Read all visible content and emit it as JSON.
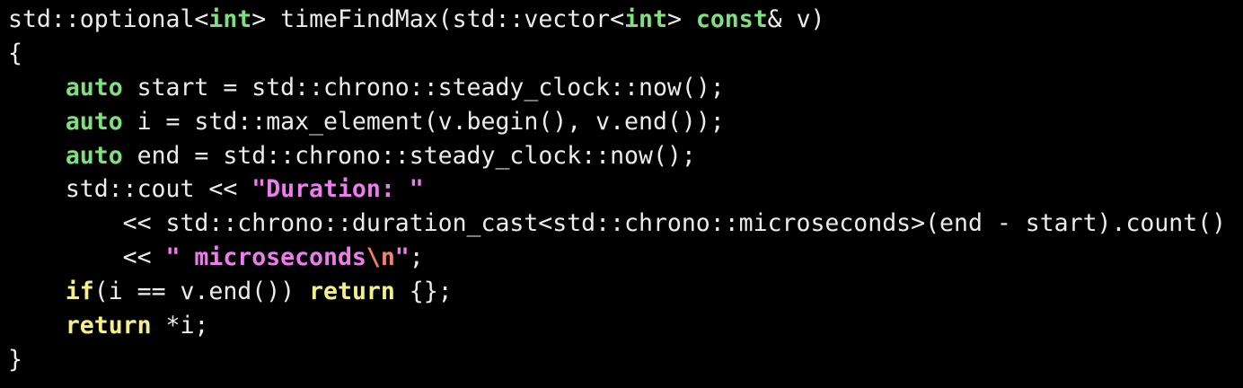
{
  "theme": {
    "background": "#000000",
    "text": "#ececec",
    "keyword_type": "#7ee07e",
    "keyword_control": "#f3f08a",
    "string": "#ee7cee",
    "escape": "#f4826a"
  },
  "code": {
    "language": "C++",
    "lines": [
      {
        "tokens": [
          {
            "t": "plain",
            "v": "std::optional<"
          },
          {
            "t": "kw",
            "v": "int"
          },
          {
            "t": "plain",
            "v": "> timeFindMax(std::vector<"
          },
          {
            "t": "kw",
            "v": "int"
          },
          {
            "t": "plain",
            "v": "> "
          },
          {
            "t": "kw",
            "v": "const"
          },
          {
            "t": "plain",
            "v": "& v)"
          }
        ]
      },
      {
        "tokens": [
          {
            "t": "plain",
            "v": "{"
          }
        ]
      },
      {
        "tokens": [
          {
            "t": "plain",
            "v": "    "
          },
          {
            "t": "kw",
            "v": "auto"
          },
          {
            "t": "plain",
            "v": " start = std::chrono::steady_clock::now();"
          }
        ]
      },
      {
        "tokens": [
          {
            "t": "plain",
            "v": "    "
          },
          {
            "t": "kw",
            "v": "auto"
          },
          {
            "t": "plain",
            "v": " i = std::max_element(v.begin(), v.end());"
          }
        ]
      },
      {
        "tokens": [
          {
            "t": "plain",
            "v": "    "
          },
          {
            "t": "kw",
            "v": "auto"
          },
          {
            "t": "plain",
            "v": " end = std::chrono::steady_clock::now();"
          }
        ]
      },
      {
        "tokens": [
          {
            "t": "plain",
            "v": "    std::cout << "
          },
          {
            "t": "str",
            "v": "\"Duration: \""
          }
        ]
      },
      {
        "tokens": [
          {
            "t": "plain",
            "v": "        << std::chrono::duration_cast<std::chrono::microseconds>(end - start).count()"
          }
        ]
      },
      {
        "tokens": [
          {
            "t": "plain",
            "v": "        << "
          },
          {
            "t": "str",
            "v": "\" microseconds"
          },
          {
            "t": "esc",
            "v": "\\n"
          },
          {
            "t": "str",
            "v": "\""
          },
          {
            "t": "plain",
            "v": ";"
          }
        ]
      },
      {
        "tokens": [
          {
            "t": "plain",
            "v": "    "
          },
          {
            "t": "ctl",
            "v": "if"
          },
          {
            "t": "plain",
            "v": "(i == v.end()) "
          },
          {
            "t": "ctl",
            "v": "return"
          },
          {
            "t": "plain",
            "v": " {};"
          }
        ]
      },
      {
        "tokens": [
          {
            "t": "plain",
            "v": "    "
          },
          {
            "t": "ctl",
            "v": "return"
          },
          {
            "t": "plain",
            "v": " *i;"
          }
        ]
      },
      {
        "tokens": [
          {
            "t": "plain",
            "v": "}"
          }
        ]
      }
    ]
  }
}
